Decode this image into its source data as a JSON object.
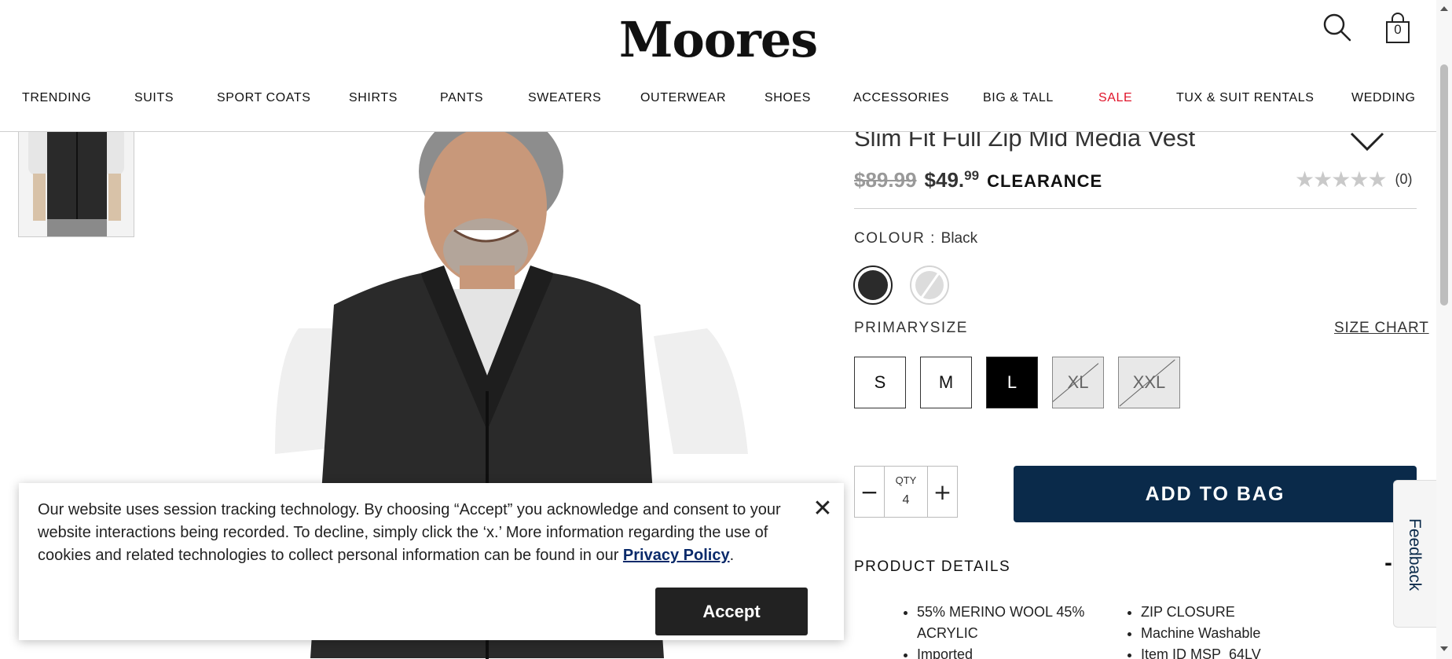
{
  "header": {
    "logo": "Moores",
    "bag_count": "0",
    "icons": {
      "search": "search-icon",
      "bag": "shopping-bag-icon"
    }
  },
  "nav": {
    "items": [
      {
        "label": "TRENDING"
      },
      {
        "label": "SUITS"
      },
      {
        "label": "SPORT COATS"
      },
      {
        "label": "SHIRTS"
      },
      {
        "label": "PANTS"
      },
      {
        "label": "SWEATERS"
      },
      {
        "label": "OUTERWEAR"
      },
      {
        "label": "SHOES"
      },
      {
        "label": "ACCESSORIES"
      },
      {
        "label": "BIG & TALL"
      },
      {
        "label": "SALE",
        "color": "#e0142a"
      },
      {
        "label": "TUX & SUIT RENTALS"
      },
      {
        "label": "WEDDING"
      }
    ]
  },
  "product": {
    "title": "Slim Fit Full Zip Mid Media Vest",
    "old_price": "$89.99",
    "new_price_main": "$49.",
    "new_price_cents": "99",
    "badge": "CLEARANCE",
    "rating_stars": 0,
    "review_count": "(0)",
    "colour_label": "COLOUR :",
    "colour_value": "Black",
    "colours": [
      {
        "name": "black",
        "hex": "#2b2b2b",
        "selected": true,
        "available": true
      },
      {
        "name": "grey",
        "hex": "#dcdcdc",
        "selected": false,
        "available": false
      }
    ],
    "size_label": "PRIMARYSIZE",
    "size_chart_label": "SIZE CHART",
    "sizes": [
      {
        "label": "S",
        "state": "available"
      },
      {
        "label": "M",
        "state": "available"
      },
      {
        "label": "L",
        "state": "selected"
      },
      {
        "label": "XL",
        "state": "unavailable"
      },
      {
        "label": "XXL",
        "state": "unavailable"
      }
    ],
    "qty_label": "QTY",
    "qty_value": "4",
    "qty_minus": "−",
    "qty_plus": "+",
    "add_to_bag_label": "ADD TO BAG",
    "details_header": "PRODUCT DETAILS",
    "details_toggle": "-",
    "details_left": [
      "55% MERINO WOOL 45% ACRYLIC",
      "Imported"
    ],
    "details_right": [
      "ZIP CLOSURE",
      "Machine Washable",
      "Item ID MSP_64LV"
    ]
  },
  "feedback_label": "Feedback",
  "cookie": {
    "text_before": "Our website uses session tracking technology. By choosing “Accept” you acknowledge and consent to your website interactions being recorded. To decline, simply click the ‘x.’ More information regarding the use of cookies and related technologies to collect personal information can be found in our ",
    "link": "Privacy Policy",
    "text_after": ".",
    "close": "✕",
    "accept_label": "Accept"
  },
  "colors": {
    "accent_navy": "#0a2a4a",
    "sale_red": "#e0142a",
    "selected_size": "#000000"
  }
}
